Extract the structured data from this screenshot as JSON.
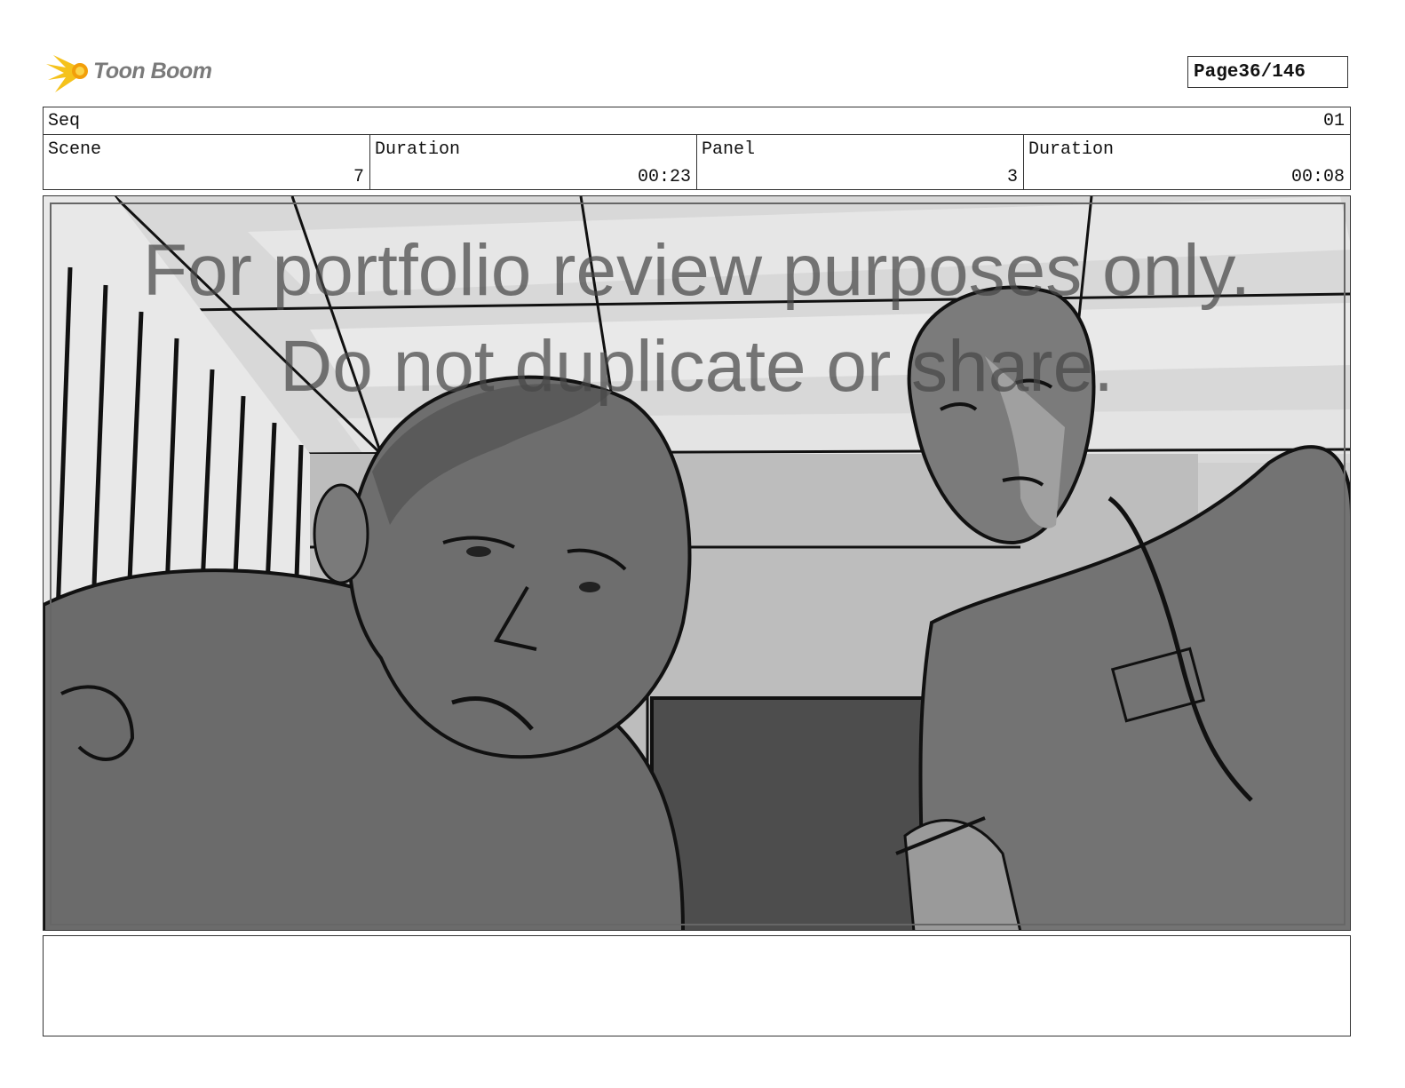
{
  "header": {
    "logo_text": "Toon Boom",
    "page_label": "Page",
    "page_value": "36/146"
  },
  "seq": {
    "label": "Seq",
    "value": "01"
  },
  "info": {
    "scene_label": "Scene",
    "scene_value": "7",
    "scene_duration_label": "Duration",
    "scene_duration_value": "00:23",
    "panel_label": "Panel",
    "panel_value": "3",
    "panel_duration_label": "Duration",
    "panel_duration_value": "00:08"
  },
  "watermark": {
    "line1": "For portfolio review purposes only.",
    "line2": "Do not duplicate or share."
  },
  "notes": {
    "text": ""
  }
}
